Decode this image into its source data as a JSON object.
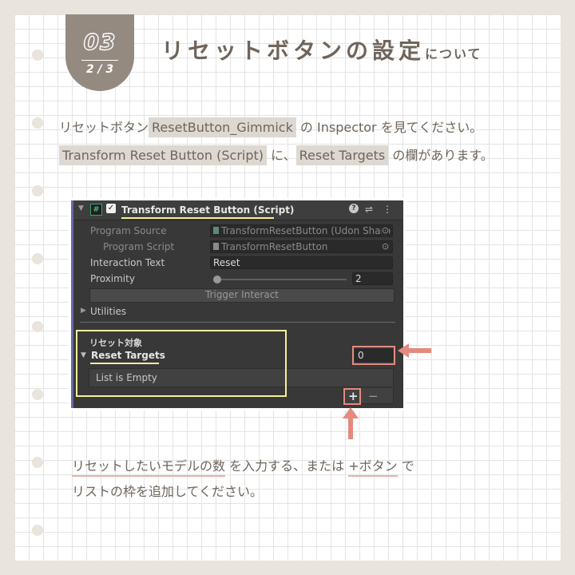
{
  "badge": {
    "number": "03",
    "fraction": "2 / 3"
  },
  "title": {
    "main": "リセットボタンの設定",
    "suffix": "について"
  },
  "intro": {
    "l1_a": "リセットボタン",
    "l1_chip": "ResetButton_Gimmick",
    "l1_b": " の Inspector を見てください。",
    "l2_chip1": "Transform Reset Button (Script)",
    "l2_a": " に、",
    "l2_chip2": "Reset Targets",
    "l2_b": " の欄があります。"
  },
  "inspector": {
    "component_title": "Transform Reset Button (Script)",
    "program_source_label": "Program Source",
    "program_source_value": "TransformResetButton (Udon Sharp",
    "program_script_label": "Program Script",
    "program_script_value": "TransformResetButton",
    "interaction_text_label": "Interaction Text",
    "interaction_text_value": "Reset",
    "proximity_label": "Proximity",
    "proximity_value": "2",
    "proximity_fraction": 0.0,
    "trigger_interact_label": "Trigger Interact",
    "utilities_label": "Utilities",
    "reset_section_label": "リセット対象",
    "reset_targets_label": "Reset Targets",
    "reset_targets_count": "0",
    "list_empty_label": "List is Empty",
    "add_label": "+",
    "remove_label": "−",
    "icons": {
      "hash": "#",
      "check": "✓",
      "help": "?",
      "preset": "⇌",
      "menu": "⋮"
    }
  },
  "footer": {
    "l1_u1": "リセットしたいモデルの数",
    "l1_a": " を入力する、または ",
    "l1_u2": "+ボタン",
    "l1_b": " で",
    "l2": "リストの枠を追加してください。"
  },
  "colors": {
    "accent": "#e48a7e",
    "highlight": "#f6ef9c",
    "text": "#6f655c",
    "badge": "#948a80"
  }
}
